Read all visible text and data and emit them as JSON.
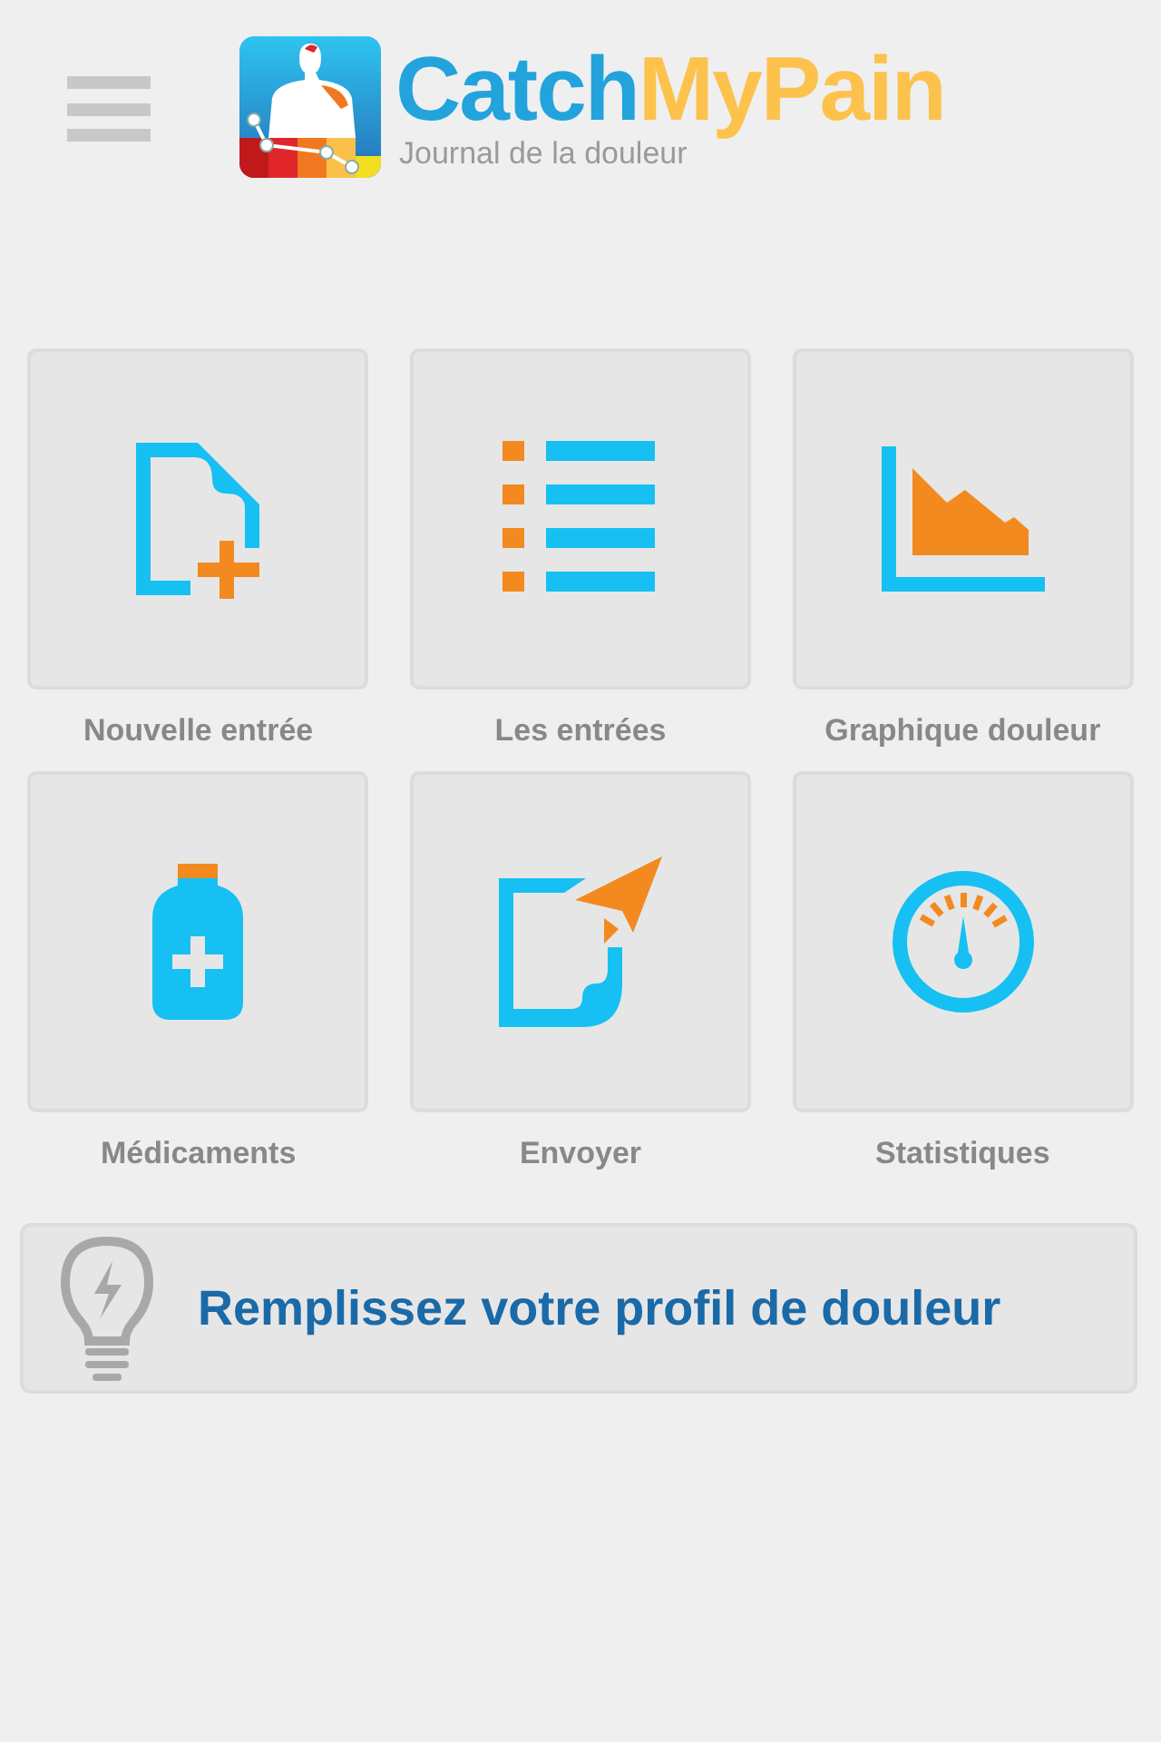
{
  "header": {
    "logo": {
      "title_parts": [
        "Catch",
        "MyPain"
      ],
      "subtitle": "Journal de la douleur"
    }
  },
  "tiles": [
    {
      "kind": "new-entry",
      "label": "Nouvelle entrée"
    },
    {
      "kind": "entries",
      "label": "Les entrées"
    },
    {
      "kind": "chart",
      "label": "Graphique douleur"
    },
    {
      "kind": "medication",
      "label": "Médicaments"
    },
    {
      "kind": "send",
      "label": "Envoyer"
    },
    {
      "kind": "statistics",
      "label": "Statistiques"
    }
  ],
  "banner": {
    "text": "Remplissez votre profil de douleur"
  }
}
